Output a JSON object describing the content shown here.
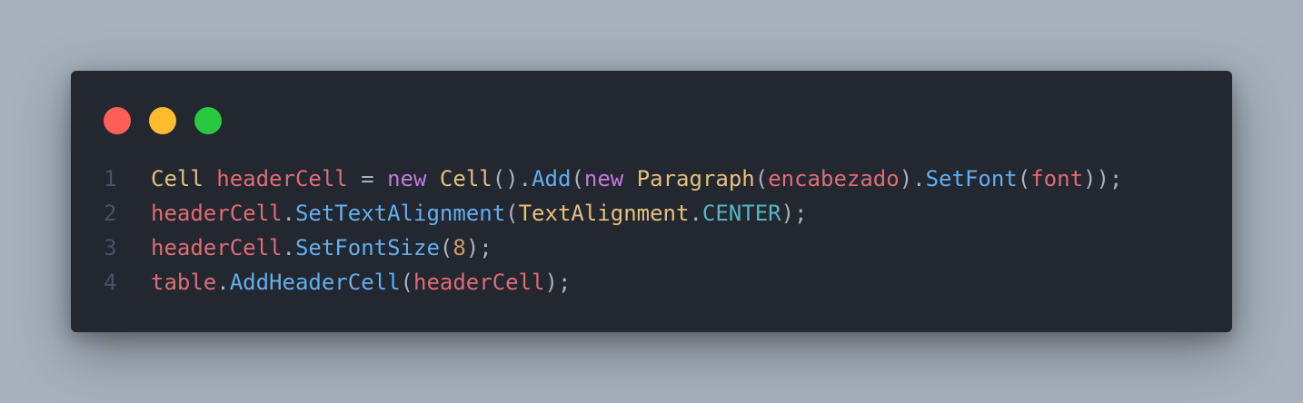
{
  "window": {
    "controls": [
      {
        "name": "close",
        "color": "#ff5f57"
      },
      {
        "name": "minimize",
        "color": "#febc2e"
      },
      {
        "name": "maximize",
        "color": "#28c840"
      }
    ]
  },
  "colors": {
    "type": "#e5c07b",
    "variable": "#e06c75",
    "keyword": "#c678dd",
    "method": "#61afef",
    "punct": "#abb2bf",
    "constant": "#56b6c2",
    "number": "#d19a66"
  },
  "code": {
    "lines": [
      {
        "number": "1",
        "tokens": [
          {
            "text": "Cell",
            "kind": "type"
          },
          {
            "text": " ",
            "kind": "punct"
          },
          {
            "text": "headerCell",
            "kind": "variable"
          },
          {
            "text": " = ",
            "kind": "punct"
          },
          {
            "text": "new",
            "kind": "keyword"
          },
          {
            "text": " ",
            "kind": "punct"
          },
          {
            "text": "Cell",
            "kind": "type"
          },
          {
            "text": "().",
            "kind": "punct"
          },
          {
            "text": "Add",
            "kind": "method"
          },
          {
            "text": "(",
            "kind": "punct"
          },
          {
            "text": "new",
            "kind": "keyword"
          },
          {
            "text": " ",
            "kind": "punct"
          },
          {
            "text": "Paragraph",
            "kind": "type"
          },
          {
            "text": "(",
            "kind": "punct"
          },
          {
            "text": "encabezado",
            "kind": "variable"
          },
          {
            "text": ").",
            "kind": "punct"
          },
          {
            "text": "SetFont",
            "kind": "method"
          },
          {
            "text": "(",
            "kind": "punct"
          },
          {
            "text": "font",
            "kind": "variable"
          },
          {
            "text": "));",
            "kind": "punct"
          }
        ]
      },
      {
        "number": "2",
        "tokens": [
          {
            "text": "headerCell",
            "kind": "variable"
          },
          {
            "text": ".",
            "kind": "punct"
          },
          {
            "text": "SetTextAlignment",
            "kind": "method"
          },
          {
            "text": "(",
            "kind": "punct"
          },
          {
            "text": "TextAlignment",
            "kind": "type"
          },
          {
            "text": ".",
            "kind": "punct"
          },
          {
            "text": "CENTER",
            "kind": "constant"
          },
          {
            "text": ");",
            "kind": "punct"
          }
        ]
      },
      {
        "number": "3",
        "tokens": [
          {
            "text": "headerCell",
            "kind": "variable"
          },
          {
            "text": ".",
            "kind": "punct"
          },
          {
            "text": "SetFontSize",
            "kind": "method"
          },
          {
            "text": "(",
            "kind": "punct"
          },
          {
            "text": "8",
            "kind": "number"
          },
          {
            "text": ");",
            "kind": "punct"
          }
        ]
      },
      {
        "number": "4",
        "tokens": [
          {
            "text": "table",
            "kind": "variable"
          },
          {
            "text": ".",
            "kind": "punct"
          },
          {
            "text": "AddHeaderCell",
            "kind": "method"
          },
          {
            "text": "(",
            "kind": "punct"
          },
          {
            "text": "headerCell",
            "kind": "variable"
          },
          {
            "text": ");",
            "kind": "punct"
          }
        ]
      }
    ]
  }
}
